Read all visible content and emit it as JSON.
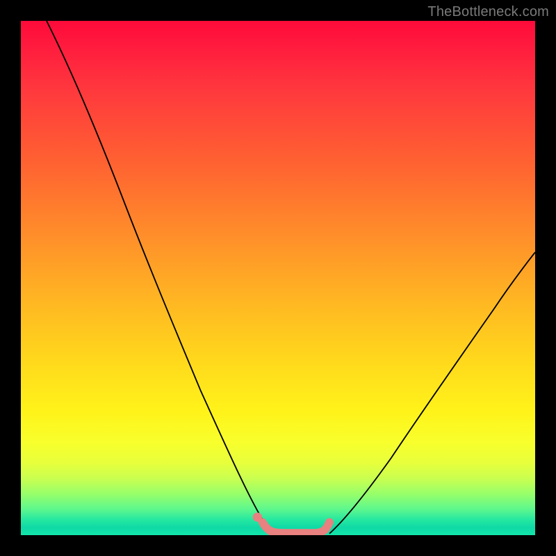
{
  "watermark": "TheBottleneck.com",
  "chart_data": {
    "type": "line",
    "title": "",
    "xlabel": "",
    "ylabel": "",
    "xlim": [
      0,
      100
    ],
    "ylim": [
      0,
      100
    ],
    "background_gradient": {
      "top_color": "#ff0a3a",
      "bottom_color": "#12e6ab",
      "meaning": "red = high bottleneck %, green = 0% bottleneck"
    },
    "series": [
      {
        "name": "left-curve",
        "stroke": "#000000",
        "x": [
          5,
          10,
          15,
          20,
          25,
          30,
          35,
          40,
          44,
          47,
          49
        ],
        "y": [
          100,
          90,
          78,
          65,
          52,
          40,
          28,
          17,
          8,
          3,
          1
        ]
      },
      {
        "name": "right-curve",
        "stroke": "#000000",
        "x": [
          60,
          63,
          67,
          72,
          78,
          85,
          92,
          100
        ],
        "y": [
          1,
          3,
          8,
          15,
          24,
          34,
          44,
          55
        ]
      },
      {
        "name": "optimal-band-marker",
        "stroke": "#e8817f",
        "x": [
          47,
          49,
          51,
          54,
          57,
          59,
          60
        ],
        "y": [
          2,
          0.5,
          0.3,
          0.3,
          0.3,
          0.6,
          2
        ]
      }
    ],
    "markers": [
      {
        "name": "marker-dot",
        "x": 46,
        "y": 3,
        "color": "#e8817f"
      }
    ]
  }
}
